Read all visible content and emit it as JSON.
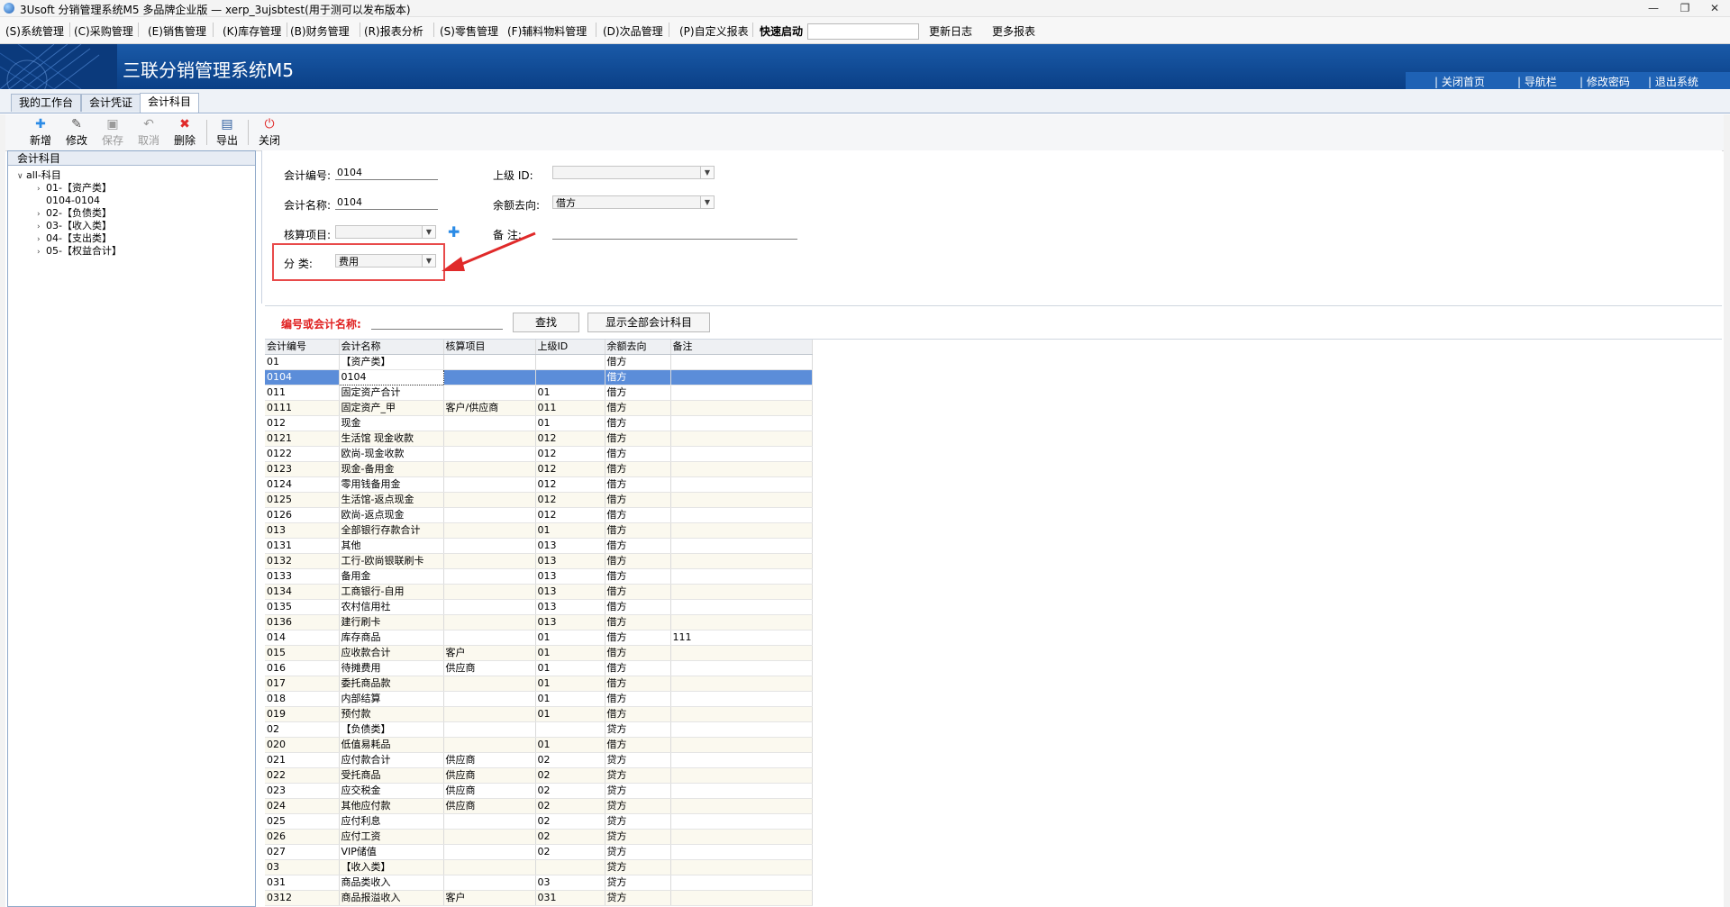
{
  "window": {
    "title": "3Usoft 分销管理系统M5 多品牌企业版 — xerp_3ujsbtest(用于测可以发布版本)",
    "min": "—",
    "restore": "❐",
    "close": "✕"
  },
  "menu": {
    "items": [
      "(S)系统管理",
      "(C)采购管理",
      "(E)销售管理",
      "(K)库存管理",
      "(B)财务管理",
      "(R)报表分析",
      "(S)零售管理",
      "(F)辅料物料管理",
      "(D)次品管理",
      "(P)自定义报表"
    ],
    "quick_start_label": "快速启动",
    "quick_start_value": "",
    "update_log": "更新日志",
    "more_reports": "更多报表"
  },
  "banner": {
    "title": "三联分销管理系统M5",
    "links": [
      "关闭首页",
      "导航栏",
      "修改密码",
      "退出系统"
    ]
  },
  "tabs": [
    "我的工作台",
    "会计凭证",
    "会计科目"
  ],
  "active_tab": 2,
  "toolbar": {
    "buttons": [
      {
        "label": "新增",
        "icon": "plus-icon"
      },
      {
        "label": "修改",
        "icon": "edit-icon"
      },
      {
        "label": "保存",
        "icon": "save-icon"
      },
      {
        "label": "取消",
        "icon": "undo-icon"
      },
      {
        "label": "删除",
        "icon": "delete-icon"
      },
      {
        "label": "导出",
        "icon": "export-icon"
      },
      {
        "label": "关闭",
        "icon": "power-icon"
      }
    ]
  },
  "tree": {
    "header": "会计科目",
    "root": "all-科目",
    "children": [
      "01-【资产类】",
      "0104-0104",
      "02-【负债类】",
      "03-【收入类】",
      "04-【支出类】",
      "05-【权益合计】"
    ]
  },
  "form": {
    "code_label": "会计编号:",
    "code_value": "0104",
    "parent_label": "上级  ID:",
    "parent_value": "",
    "name_label": "会计名称:",
    "name_value": "0104",
    "direction_label": "余额去向:",
    "direction_value": "借方",
    "audit_label": "核算项目:",
    "audit_value": "",
    "remark_label": "备    注:",
    "remark_value": "",
    "category_label": "分    类:",
    "category_value": "费用"
  },
  "search": {
    "label": "编号或会计名称:",
    "value": "",
    "find_button": "查找",
    "show_all_button": "显示全部会计科目"
  },
  "grid": {
    "columns": [
      "会计编号",
      "会计名称",
      "核算项目",
      "上级ID",
      "余额去向",
      "备注"
    ],
    "selected_index": 1,
    "rows": [
      [
        "01",
        "【资产类】",
        "",
        "",
        "借方",
        ""
      ],
      [
        "0104",
        "0104",
        "",
        "",
        "借方",
        ""
      ],
      [
        "011",
        "固定资产合计",
        "",
        "01",
        "借方",
        ""
      ],
      [
        "0111",
        "固定资产_甲",
        "客户/供应商",
        "011",
        "借方",
        ""
      ],
      [
        "012",
        "现金",
        "",
        "01",
        "借方",
        ""
      ],
      [
        "0121",
        "生活馆 现金收款",
        "",
        "012",
        "借方",
        ""
      ],
      [
        "0122",
        "欧尚-现金收款",
        "",
        "012",
        "借方",
        ""
      ],
      [
        "0123",
        "现金-备用金",
        "",
        "012",
        "借方",
        ""
      ],
      [
        "0124",
        "零用钱备用金",
        "",
        "012",
        "借方",
        ""
      ],
      [
        "0125",
        "生活馆-返点现金",
        "",
        "012",
        "借方",
        ""
      ],
      [
        "0126",
        "欧尚-返点现金",
        "",
        "012",
        "借方",
        ""
      ],
      [
        "013",
        "全部银行存款合计",
        "",
        "01",
        "借方",
        ""
      ],
      [
        "0131",
        "其他",
        "",
        "013",
        "借方",
        ""
      ],
      [
        "0132",
        "工行-欧尚银联刷卡",
        "",
        "013",
        "借方",
        ""
      ],
      [
        "0133",
        "备用金",
        "",
        "013",
        "借方",
        ""
      ],
      [
        "0134",
        "工商银行-自用",
        "",
        "013",
        "借方",
        ""
      ],
      [
        "0135",
        "农村信用社",
        "",
        "013",
        "借方",
        ""
      ],
      [
        "0136",
        "建行刷卡",
        "",
        "013",
        "借方",
        ""
      ],
      [
        "014",
        "库存商品",
        "",
        "01",
        "借方",
        "111"
      ],
      [
        "015",
        "应收款合计",
        "客户",
        "01",
        "借方",
        ""
      ],
      [
        "016",
        "待摊费用",
        "供应商",
        "01",
        "借方",
        ""
      ],
      [
        "017",
        "委托商品款",
        "",
        "01",
        "借方",
        ""
      ],
      [
        "018",
        "内部结算",
        "",
        "01",
        "借方",
        ""
      ],
      [
        "019",
        "预付款",
        "",
        "01",
        "借方",
        ""
      ],
      [
        "02",
        "【负债类】",
        "",
        "",
        "贷方",
        ""
      ],
      [
        "020",
        "低值易耗品",
        "",
        "01",
        "借方",
        ""
      ],
      [
        "021",
        "应付款合计",
        "供应商",
        "02",
        "贷方",
        ""
      ],
      [
        "022",
        "受托商品",
        "供应商",
        "02",
        "贷方",
        ""
      ],
      [
        "023",
        "应交税金",
        "供应商",
        "02",
        "贷方",
        ""
      ],
      [
        "024",
        "其他应付款",
        "供应商",
        "02",
        "贷方",
        ""
      ],
      [
        "025",
        "应付利息",
        "",
        "02",
        "贷方",
        ""
      ],
      [
        "026",
        "应付工资",
        "",
        "02",
        "贷方",
        ""
      ],
      [
        "027",
        "VIP储值",
        "",
        "02",
        "贷方",
        ""
      ],
      [
        "03",
        "【收入类】",
        "",
        "",
        "贷方",
        ""
      ],
      [
        "031",
        "商品类收入",
        "",
        "03",
        "贷方",
        ""
      ],
      [
        "0312",
        "商品报溢收入",
        "客户",
        "031",
        "贷方",
        ""
      ]
    ]
  },
  "colors": {
    "banner": "#0a3f86",
    "selected_row": "#5b8dd9",
    "highlight": "#e84a4a",
    "search_label": "#e02020"
  }
}
